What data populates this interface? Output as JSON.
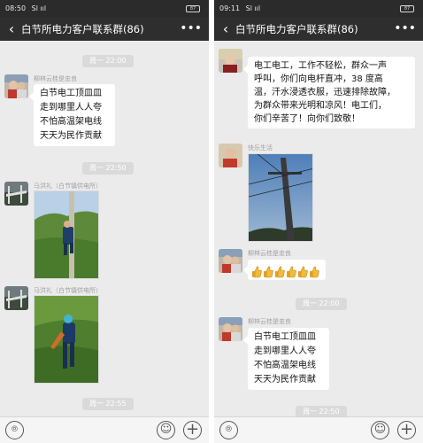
{
  "left": {
    "status": {
      "time": "08:50",
      "signal": "Sl ııl",
      "battery": "87"
    },
    "header": {
      "back_icon": "back-arrow-icon",
      "title": "白节所电力客户联系群(86)",
      "more_icon": "more-dots-icon"
    },
    "timestamps": [
      "周一 22:00",
      "周一 22:50",
      "周一 22:55"
    ],
    "messages": [
      {
        "sender": "柳林云桂是忠良",
        "lines": [
          "白节电工顶皿皿",
          "走到哪里人人夸",
          "不怕高温架电线",
          "天天为民作贡献"
        ]
      },
      {
        "sender": "马洪礼（白节镇供电所）",
        "image": "lineman-climbing-pole-photo"
      },
      {
        "sender": "马洪礼（白节镇供电所）",
        "image": "worker-cutting-grass-photo"
      }
    ]
  },
  "right": {
    "status": {
      "time": "09:11",
      "signal": "Sl ııl",
      "battery": "87"
    },
    "header": {
      "back_icon": "back-arrow-icon",
      "title": "白节所电力客户联系群(86)",
      "more_icon": "more-dots-icon"
    },
    "timestamps": [
      "周一 22:00",
      "周一 22:50"
    ],
    "messages": [
      {
        "sender": "",
        "lines": [
          "电工电工，工作不轻松，群众一声",
          "呼叫，你们向电杆直冲，38 度高",
          "温，汗水浸透衣服，迅速排除故障，",
          "为群众带来光明和凉风！电工们，",
          "你们辛苦了！向你们致敬！"
        ]
      },
      {
        "sender": "快乐生活",
        "image": "power-pole-sky-photo"
      },
      {
        "sender": "柳林云桂是忠良",
        "reaction": "thumbs-up-emoji",
        "reaction_count": 6
      },
      {
        "sender": "柳林云桂是忠良",
        "lines": [
          "白节电工顶皿皿",
          "走到哪里人人夸",
          "不怕高温架电线",
          "天天为民作贡献"
        ]
      }
    ]
  },
  "input": {
    "voice_icon": "voice-icon",
    "emoji_icon": "emoji-icon",
    "plus_icon": "plus-icon"
  }
}
